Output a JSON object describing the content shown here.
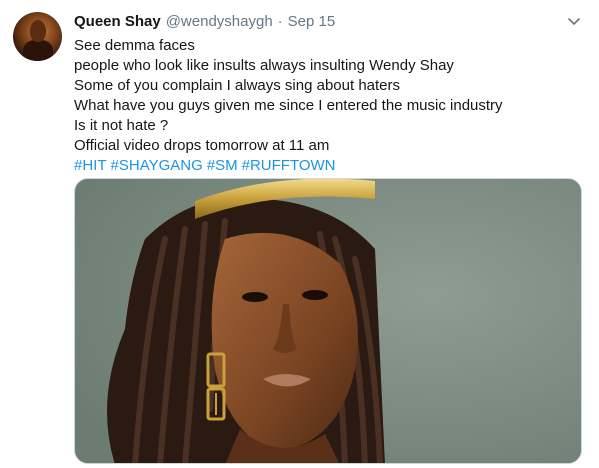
{
  "tweet": {
    "display_name": "Queen Shay",
    "handle": "@wendyshaygh",
    "separator": "·",
    "date": "Sep 15",
    "lines": [
      "See demma faces",
      "people who look like insults always insulting Wendy Shay",
      "Some of you complain I always sing about haters",
      "What have you guys given me since I entered the music industry",
      "Is it not hate ?",
      "Official video drops tomorrow at 11 am"
    ],
    "hashtags": [
      "#HIT",
      "#SHAYGANG",
      "#SM",
      "#RUFFTOWN"
    ]
  },
  "icons": {
    "menu": "chevron-down-icon"
  },
  "colors": {
    "text": "#14171a",
    "secondary": "#657786",
    "link": "#1b95e0",
    "media_background": "#7d8d84"
  }
}
